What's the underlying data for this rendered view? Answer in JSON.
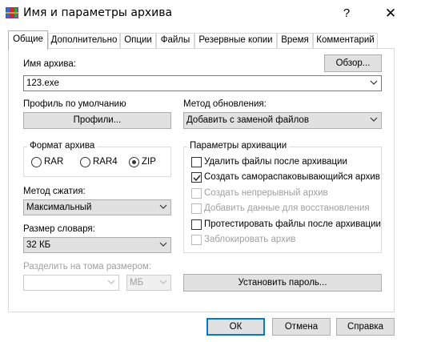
{
  "window": {
    "title": "Имя и параметры архива",
    "help_label": "?",
    "close_label": "✕"
  },
  "tabs": [
    {
      "label": "Общие",
      "active": true
    },
    {
      "label": "Дополнительно"
    },
    {
      "label": "Опции"
    },
    {
      "label": "Файлы"
    },
    {
      "label": "Резервные копии"
    },
    {
      "label": "Время"
    },
    {
      "label": "Комментарий"
    }
  ],
  "archive_name": {
    "label": "Имя архива:",
    "value": "123.exe",
    "browse_label": "Обзор..."
  },
  "profile": {
    "label": "Профиль по умолчанию",
    "button_label": "Профили..."
  },
  "update_method": {
    "label": "Метод обновления:",
    "value": "Добавить с заменой файлов"
  },
  "archive_format": {
    "label": "Формат архива",
    "options": [
      "RAR",
      "RAR4",
      "ZIP"
    ],
    "selected": "ZIP"
  },
  "archive_options": {
    "label": "Параметры архивации",
    "items": [
      {
        "label": "Удалить файлы после архивации",
        "checked": false,
        "enabled": true
      },
      {
        "label": "Создать самораспаковывающийся архив",
        "checked": true,
        "enabled": true
      },
      {
        "label": "Создать непрерывный архив",
        "checked": false,
        "enabled": false
      },
      {
        "label": "Добавить данные для восстановления",
        "checked": false,
        "enabled": false
      },
      {
        "label": "Протестировать файлы после архивации",
        "checked": false,
        "enabled": true
      },
      {
        "label": "Заблокировать архив",
        "checked": false,
        "enabled": false
      }
    ]
  },
  "compression": {
    "label": "Метод сжатия:",
    "value": "Максимальный"
  },
  "dictionary": {
    "label": "Размер словаря:",
    "value": "32 КБ"
  },
  "split": {
    "label": "Разделить на тома размером:",
    "value": "",
    "unit": "МБ"
  },
  "password_button_label": "Установить пароль...",
  "footer": {
    "ok_label": "ОК",
    "cancel_label": "Отмена",
    "help_label": "Справка"
  }
}
